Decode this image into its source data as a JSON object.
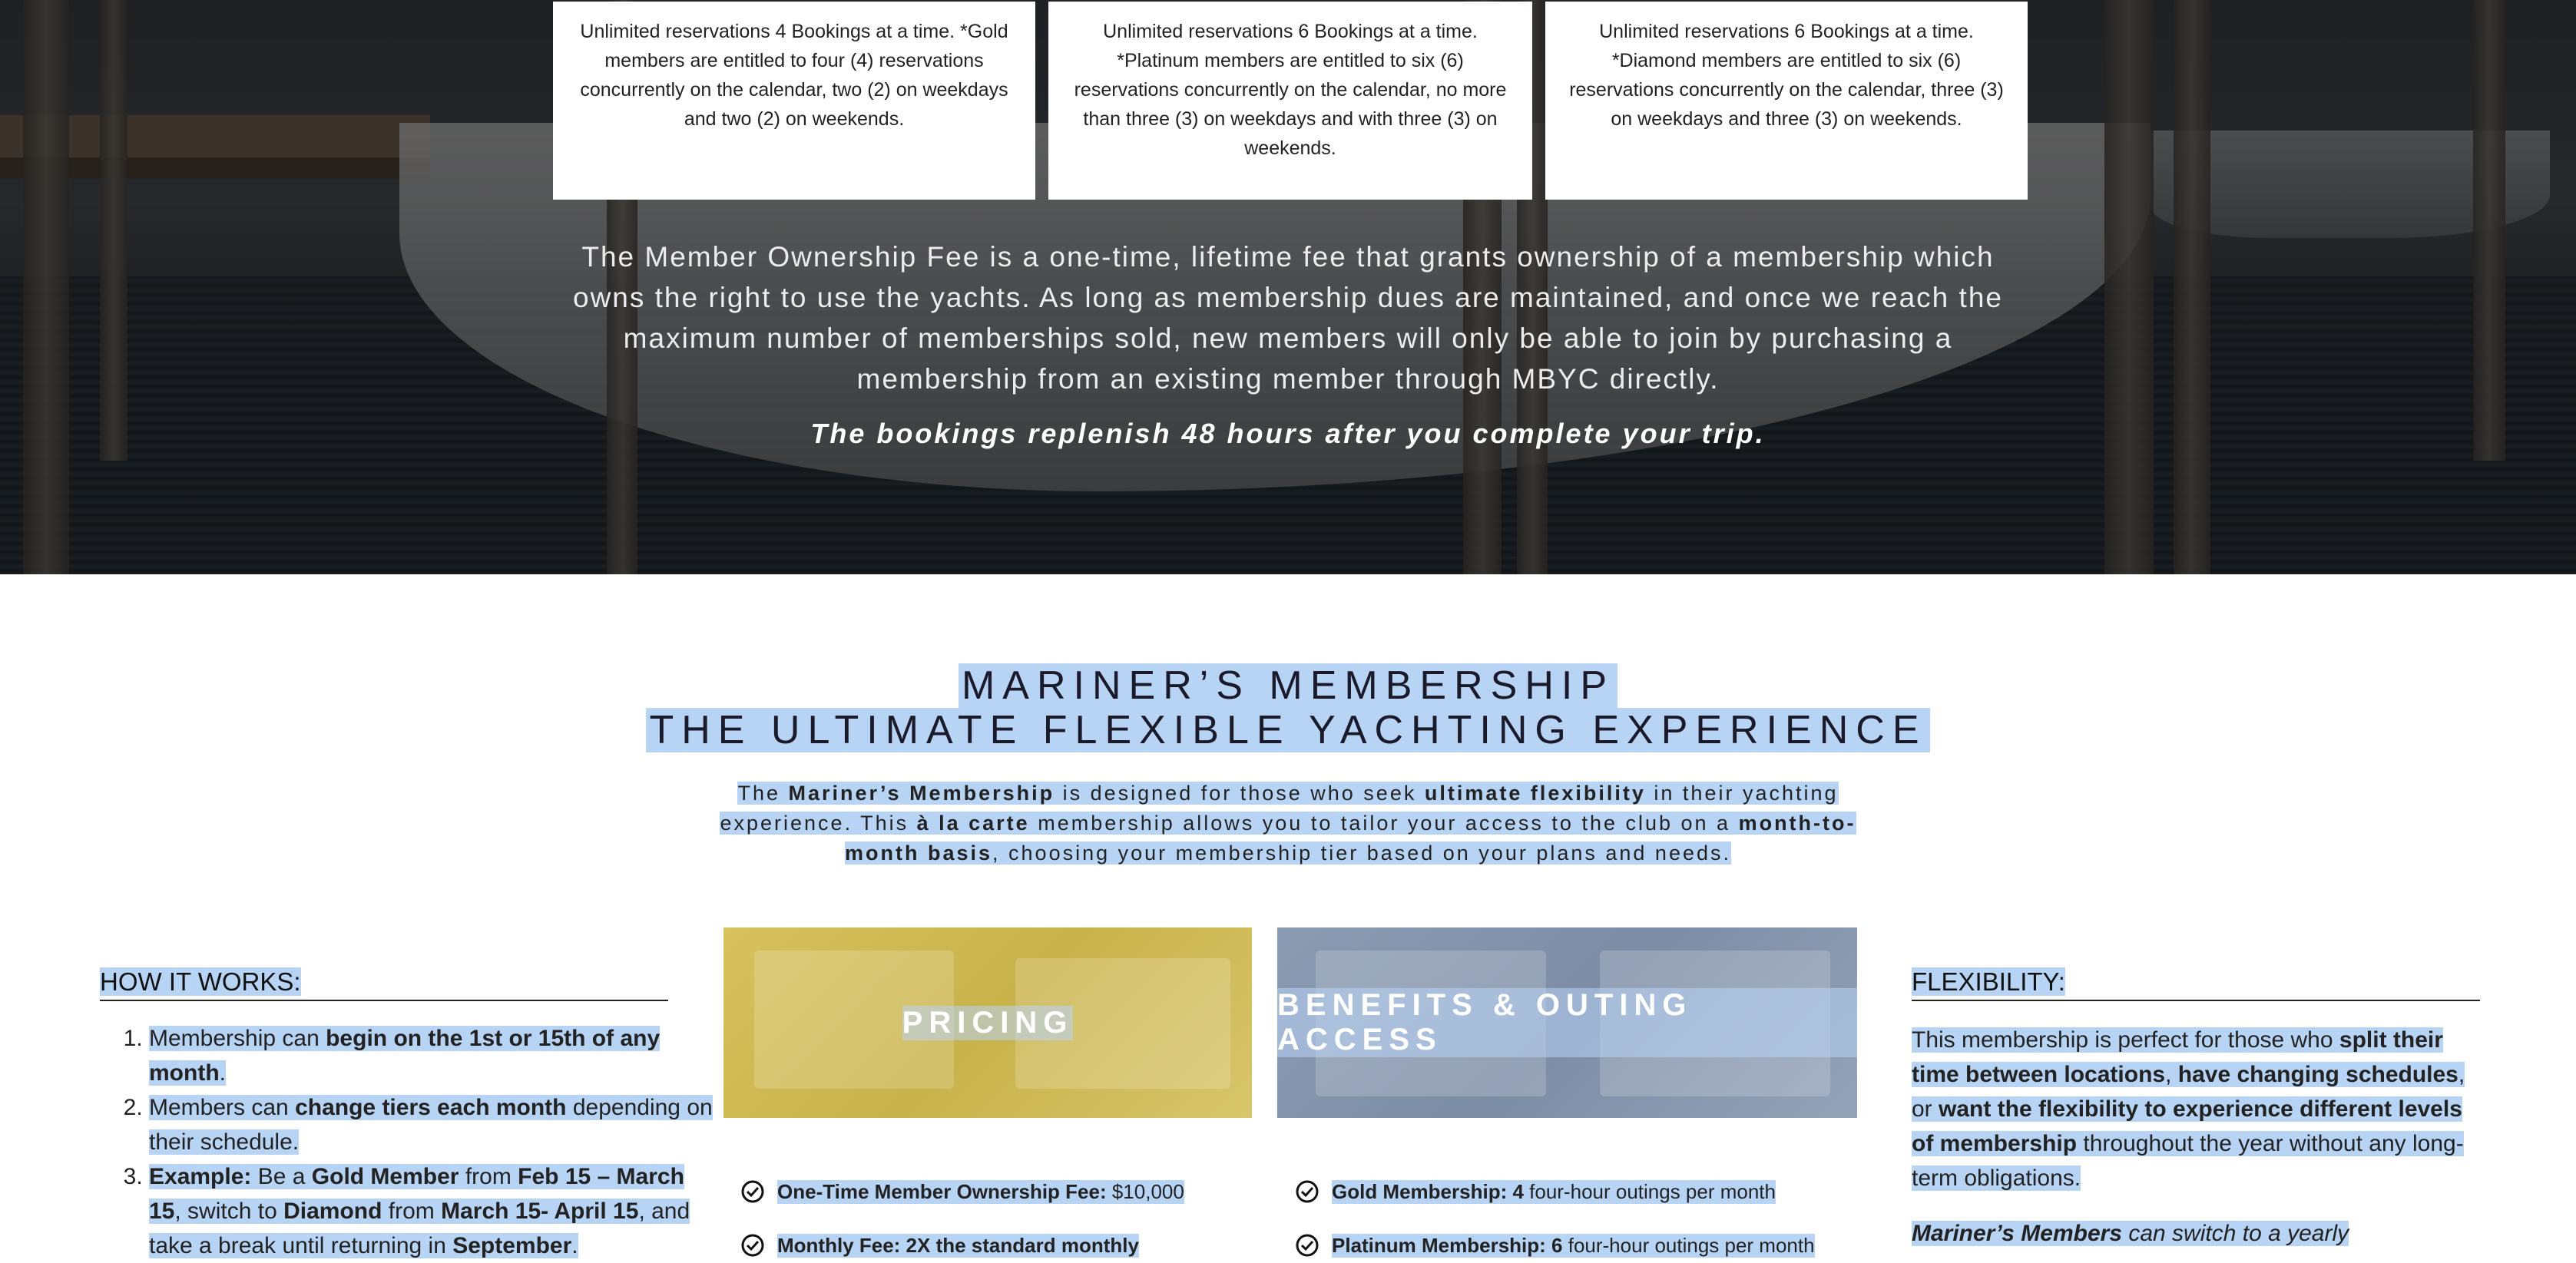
{
  "tiers": {
    "gold": "Unlimited reservations 4 Bookings at a time. *Gold members are entitled to four (4) reservations concurrently on the calendar, two (2) on weekdays and two (2) on weekends.",
    "platinum": "Unlimited reservations 6 Bookings at a time. *Platinum members are entitled to six (6) reservations concurrently on the calendar, no more than three (3) on weekdays and with three (3) on weekends.",
    "diamond": "Unlimited reservations 6 Bookings at a time. *Diamond members are entitled to six (6) reservations concurrently on the calendar, three (3) on weekdays and three (3) on weekends."
  },
  "hero": {
    "ownership_text": "The Member Ownership Fee is a one-time, lifetime fee that grants ownership of a membership which owns the right to use the yachts. As long as membership dues are maintained, and once we reach the maximum number of memberships sold, new members will only be able to join by purchasing a membership from an existing member through MBYC directly.",
    "replenish_note": "The bookings replenish 48 hours after you complete your trip."
  },
  "mariner": {
    "title_line1": "MARINER’S MEMBERSHIP",
    "title_line2": "THE ULTIMATE FLEXIBLE YACHTING EXPERIENCE",
    "desc": {
      "p1": "The ",
      "b1": "Mariner’s Membership",
      "p2": " is designed for those who seek ",
      "b2": "ultimate flexibility",
      "p3": " in their yachting experience. This ",
      "b3": "à la carte",
      "p4": " membership allows you to tailor your access to the club on a ",
      "b4": "month-to-month basis",
      "p5": ", choosing your membership tier based on your plans and needs."
    }
  },
  "how_it_works": {
    "heading": "HOW IT WORKS:",
    "item1": {
      "t1": "Membership can ",
      "b1": "begin on the 1st or 15th of any month",
      "t2": "."
    },
    "item2": {
      "t1": "Members can ",
      "b1": "change tiers each month",
      "t2": " depending on their schedule."
    },
    "item3": {
      "b1": "Example:",
      "t1": " Be a ",
      "b2": "Gold Member",
      "t2": " from ",
      "b3": "Feb 15 – March 15",
      "t3": ", switch to ",
      "b4": "Diamond",
      "t4": " from ",
      "b5": "March 15- April 15",
      "t5": ", and take a break until returning in ",
      "b6": "September",
      "t6": "."
    }
  },
  "pricing": {
    "banner": "PRICING",
    "row1_label": "One-Time Member Ownership Fee:",
    "row1_value": " $10,000",
    "row2_label": "Monthly Fee: 2X the standard monthly"
  },
  "benefits": {
    "banner": "BENEFITS & OUTING ACCESS",
    "row1_label": "Gold Membership: 4",
    "row1_value": " four-hour outings per month",
    "row2_label": "Platinum Membership: 6",
    "row2_value": " four-hour outings per month"
  },
  "flexibility": {
    "heading": "FLEXIBILITY:",
    "p1": "This membership is perfect for those who ",
    "b1": "split their time between locations",
    "p2": ", ",
    "b2": "have changing schedules",
    "p3": ", or ",
    "b3": "want the flexibility to experience different levels of membership",
    "p4": " throughout the year without any long-term obligations.",
    "p5_italic_bold": "Mariner’s Members",
    "p5_italic": " can switch to a yearly"
  },
  "colors": {
    "selection": "#b8d4f5",
    "pricing_banner": "#cdb851",
    "benefits_banner": "#8596ad"
  }
}
